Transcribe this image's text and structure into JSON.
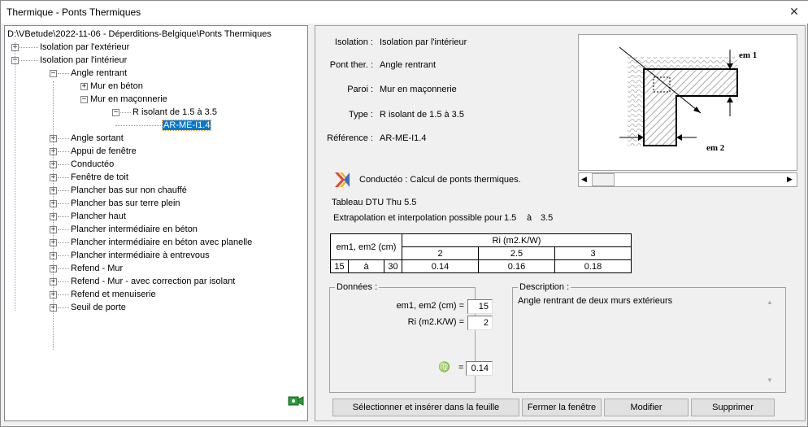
{
  "window": {
    "title": "Thermique - Ponts Thermiques",
    "close": "✕"
  },
  "tree": {
    "root": "D:\\VBetude\\2022-11-06 - Déperditions-Belgique\\Ponts Thermiques",
    "rows": [
      {
        "label": "Isolation par l'extérieur",
        "level": 1,
        "exp": "+"
      },
      {
        "label": "Isolation par l'intérieur",
        "level": 1,
        "exp": "-"
      },
      {
        "label": "Angle rentrant",
        "level": 2,
        "exp": "-"
      },
      {
        "label": "Mur en béton",
        "level": 3,
        "exp": "+"
      },
      {
        "label": "Mur en maçonnerie",
        "level": 3,
        "exp": "-"
      },
      {
        "label": "R isolant de 1.5 à 3.5",
        "level": 4,
        "exp": "-"
      },
      {
        "label": "AR-ME-I1.4",
        "level": 5,
        "exp": "",
        "selected": true
      },
      {
        "label": "Angle sortant",
        "level": 2,
        "exp": "+"
      },
      {
        "label": "Appui de fenêtre",
        "level": 2,
        "exp": "+"
      },
      {
        "label": "Conductéo",
        "level": 2,
        "exp": "+"
      },
      {
        "label": "Fenêtre de toit",
        "level": 2,
        "exp": "+"
      },
      {
        "label": "Plancher bas sur non chauffé",
        "level": 2,
        "exp": "+"
      },
      {
        "label": "Plancher bas sur terre plein",
        "level": 2,
        "exp": "+"
      },
      {
        "label": "Plancher haut",
        "level": 2,
        "exp": "+"
      },
      {
        "label": "Plancher intermédiaire en béton",
        "level": 2,
        "exp": "+"
      },
      {
        "label": "Plancher intermédiaire en béton avec planelle",
        "level": 2,
        "exp": "+"
      },
      {
        "label": "Plancher intermédiaire à entrevous",
        "level": 2,
        "exp": "+"
      },
      {
        "label": "Refend - Mur",
        "level": 2,
        "exp": "+"
      },
      {
        "label": "Refend - Mur - avec correction par isolant",
        "level": 2,
        "exp": "+"
      },
      {
        "label": "Refend et menuiserie",
        "level": 2,
        "exp": "+"
      },
      {
        "label": "Seuil de porte",
        "level": 2,
        "exp": "+"
      }
    ]
  },
  "info": [
    {
      "label": "Isolation :",
      "value": "Isolation par l'intérieur"
    },
    {
      "label": "Pont ther. :",
      "value": "Angle rentrant"
    },
    {
      "label": "Paroi :",
      "value": "Mur en maçonnerie"
    },
    {
      "label": "Type :",
      "value": "R isolant de 1.5 à 3.5"
    },
    {
      "label": "Référence :",
      "value": "AR-ME-I1.4"
    }
  ],
  "diagram": {
    "em1": "em 1",
    "em2": "em 2"
  },
  "conducteo": "Conductéo : Calcul de ponts thermiques.",
  "tableau": "Tableau DTU Thu 5.5",
  "extrap": {
    "text": "Extrapolation et interpolation possible pour",
    "min": "1.5",
    "sep": "à",
    "max": "3.5"
  },
  "table": {
    "col_header": "em1, em2 (cm)",
    "ri_header": "Ri (m2.K/W)",
    "ri_values": [
      "2",
      "2.5",
      "3"
    ],
    "row": {
      "from": "15",
      "sep": "à",
      "to": "30",
      "values": [
        "0.14",
        "0.16",
        "0.18"
      ]
    }
  },
  "donnees": {
    "legend": "Données :",
    "em_label": "em1, em2 (cm) =",
    "em_value": "15",
    "ri_label": "Ri (m2.K/W) =",
    "ri_value": "2",
    "psi_symbol": "♍",
    "psi_eq": "=",
    "psi_value": "0.14"
  },
  "description": {
    "legend": "Description :",
    "text": "Angle rentrant de deux murs extérieurs"
  },
  "buttons": {
    "select": "Sélectionner et insérer dans la feuille",
    "close": "Fermer la fenêtre",
    "modify": "Modifier",
    "delete": "Supprimer"
  }
}
